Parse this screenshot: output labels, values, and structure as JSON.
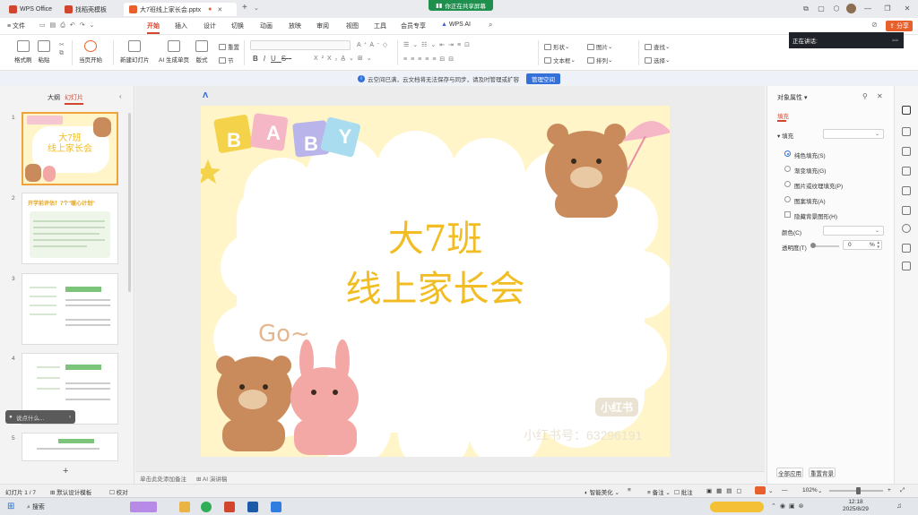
{
  "tabs": [
    {
      "label": "WPS Office",
      "color": "#d2452e"
    },
    {
      "label": "找稻壳模板",
      "color": "#d2452e"
    },
    {
      "label": "大7班线上家长会.pptx",
      "color": "#e8612c",
      "active": true
    }
  ],
  "share_banner": "你正在共享屏幕",
  "menu": {
    "file": "文件",
    "items": [
      "开始",
      "插入",
      "设计",
      "切换",
      "动画",
      "放映",
      "审阅",
      "视图",
      "工具",
      "会员专享",
      "WPS AI"
    ],
    "active_index": 0,
    "share": "分享"
  },
  "ribbon": {
    "format_painter": "格式刷",
    "paste": "粘贴",
    "from_current": "当页开始",
    "new_slide": "新建幻灯片",
    "ai_generate": "AI 生成单页",
    "layout": "版式",
    "section": "节",
    "reset": "重置",
    "shape": "形状",
    "picture": "图片",
    "textbox": "文本框",
    "arrange": "排列",
    "find": "查找",
    "select": "选择",
    "font_buttons": [
      "B",
      "I",
      "U",
      "S"
    ]
  },
  "speaker_popup": "正在讲话:",
  "notice": {
    "text": "云空间已满，云文档将无法保存与同步，请及时管理或扩容",
    "button": "管理空间"
  },
  "left_panel": {
    "tab_outline": "大纲",
    "tab_slides": "幻灯片",
    "thumbs": [
      {
        "num": "1",
        "title": "大7班\n线上家长会"
      },
      {
        "num": "2",
        "title": "开学前评估！7个\"暖心计划\""
      },
      {
        "num": "3",
        "title": ""
      },
      {
        "num": "4",
        "title": ""
      },
      {
        "num": "5",
        "title": ""
      }
    ],
    "search_placeholder": "说点什么...",
    "add_slide": "+"
  },
  "slide": {
    "title_line1": "大7班",
    "title_line2": "线上家长会",
    "blocks": [
      "B",
      "A",
      "B",
      "Y"
    ],
    "go_text": "Go~",
    "watermark_logo": "小红书",
    "watermark_id": "小红书号：63296191",
    "title_color": "#f1bd22",
    "bg_color": "#fff5c8"
  },
  "notes": {
    "placeholder": "单击此处添加备注",
    "ai_notes": "AI 演讲稿"
  },
  "right_panel": {
    "title": "对象属性",
    "tab_fill": "填充",
    "section_fill": "填充",
    "options": [
      "纯色填充(S)",
      "渐变填充(G)",
      "图片或纹理填充(P)",
      "图案填充(A)"
    ],
    "selected_option": 0,
    "hide_bg": "隐藏背景图形(H)",
    "color_label": "颜色(C)",
    "transparency_label": "透明度(T)",
    "transparency_value": "0",
    "transparency_unit": "%",
    "apply_all": "全部应用",
    "reset_bg": "重置背景"
  },
  "status": {
    "slide_counter": "幻灯片 1 / 7",
    "design_template": "默认设计模板",
    "proofread": "校对",
    "smart_beautify": "智能美化",
    "notes": "备注",
    "comment": "批注",
    "zoom": "102%"
  },
  "taskbar": {
    "search": "搜索",
    "time": "12:18",
    "date": "2025/8/29"
  }
}
